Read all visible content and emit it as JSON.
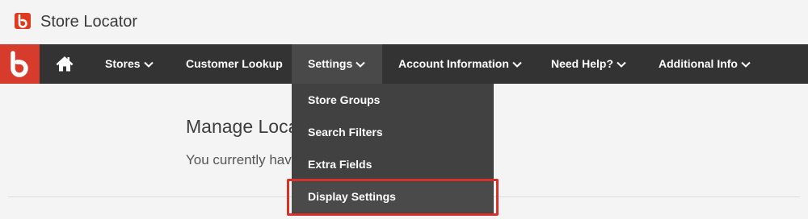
{
  "app": {
    "title": "Store Locator"
  },
  "nav": {
    "items": [
      {
        "label": "Stores",
        "has_caret": true
      },
      {
        "label": "Customer Lookup",
        "has_caret": false
      },
      {
        "label": "Settings",
        "has_caret": true,
        "active": true
      },
      {
        "label": "Account Information",
        "has_caret": true
      },
      {
        "label": "Need Help?",
        "has_caret": true
      },
      {
        "label": "Additional Info",
        "has_caret": true
      }
    ],
    "icons": {
      "home": "home-icon",
      "caret": "chevron-down-icon",
      "brand": "brand-b-logo"
    }
  },
  "settings_menu": {
    "items": [
      {
        "label": "Store Groups"
      },
      {
        "label": "Search Filters"
      },
      {
        "label": "Extra Fields"
      },
      {
        "label": "Display Settings",
        "highlighted": true
      }
    ]
  },
  "main": {
    "title": "Manage Loca",
    "text": "You currently hav"
  },
  "colors": {
    "brand": "#d63b2c",
    "navbar": "#333333",
    "dropdown": "#414141",
    "highlight_border": "#d7312a",
    "page_bg": "#f4f4f4"
  }
}
